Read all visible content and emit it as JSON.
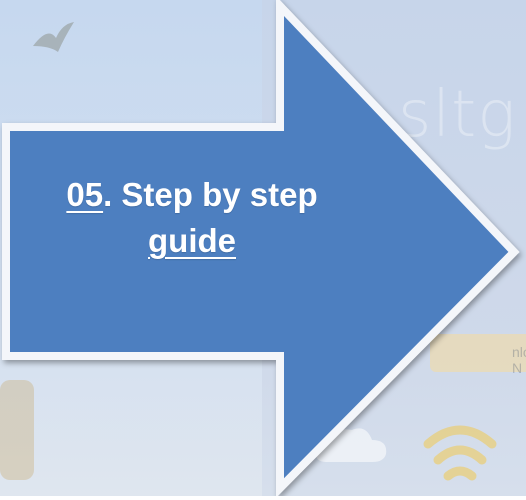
{
  "arrow": {
    "number": "05",
    "title_rest": ". Step by step",
    "title_link": "guide",
    "fill_color": "#4e7fc0",
    "border_color": "#f4f6fa"
  },
  "background": {
    "logo_text": "sltg",
    "banner_text": "nload N"
  }
}
